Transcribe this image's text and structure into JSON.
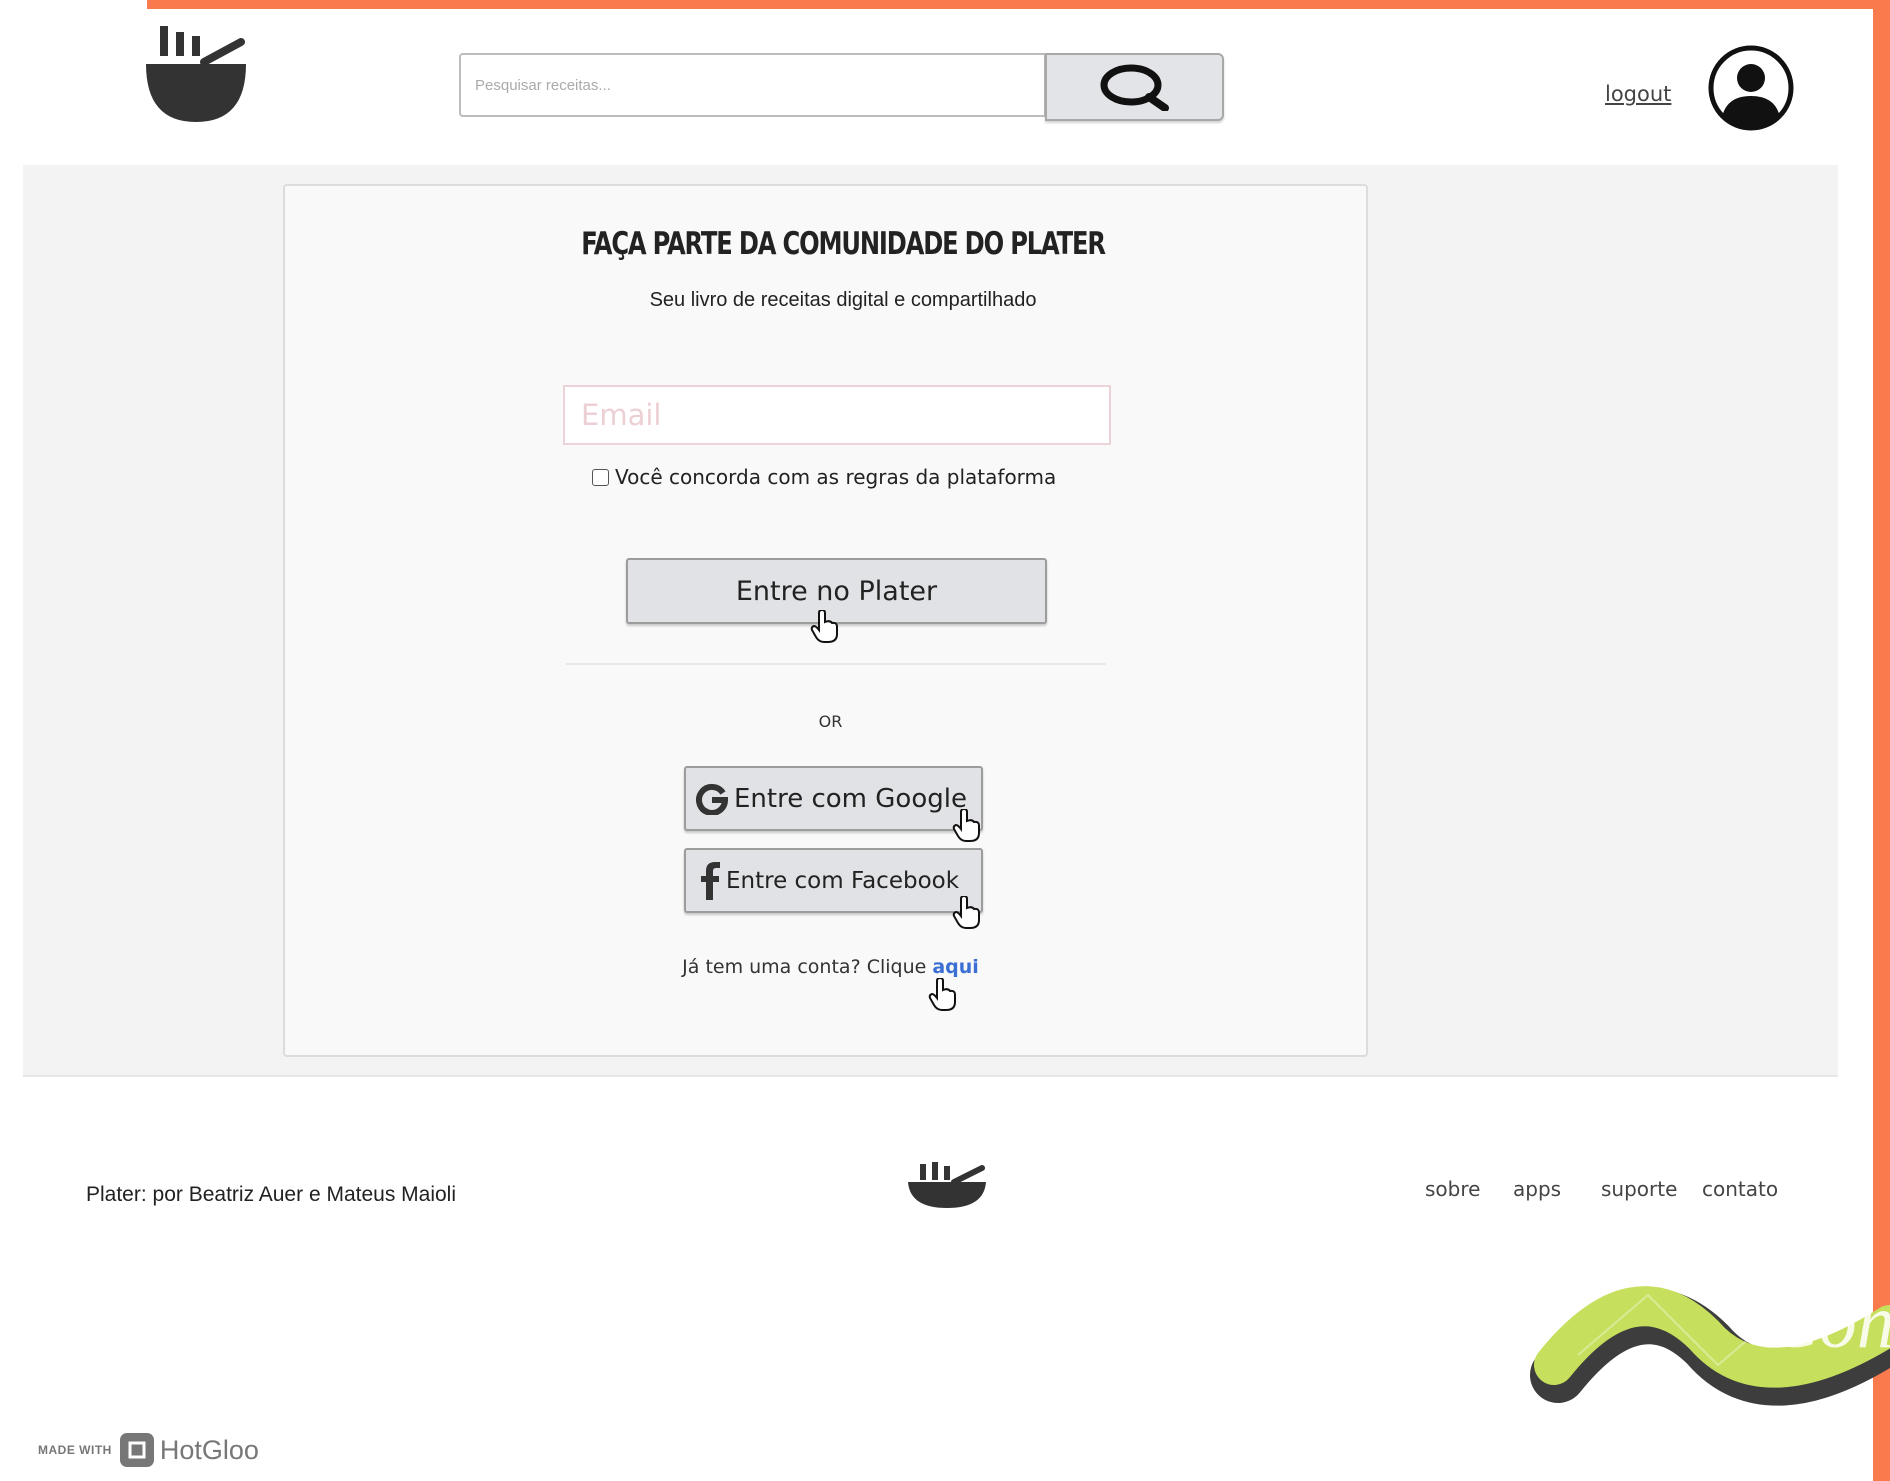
{
  "header": {
    "search": {
      "placeholder": "Pesquisar receitas..."
    },
    "logout_label": "logout"
  },
  "signup": {
    "title": "FAÇA PARTE DA COMUNIDADE DO PLATER",
    "subtitle": "Seu livro de receitas digital e compartilhado",
    "email_placeholder": "Email",
    "agree_label": "Você concorda com as regras da plataforma",
    "enter_label": "Entre no Plater",
    "or_label": "OR",
    "google_label": "Entre com Google",
    "facebook_label": "Entre com Facebook",
    "login_prompt": "Já tem uma conta? Clique ",
    "login_link": "aqui"
  },
  "footer": {
    "credit": "Plater: por Beatriz Auer e Mateus Maioli",
    "nav": [
      "sobre",
      "apps",
      "suporte",
      "contato"
    ]
  },
  "badge": {
    "made_with": "MADE WITH",
    "brand": "HotGloo"
  },
  "decoration": {
    "script_text": "Con"
  },
  "colors": {
    "frame_accent": "#f97a4c",
    "link": "#3b6fd4",
    "squiggle": "#c6e05e"
  }
}
